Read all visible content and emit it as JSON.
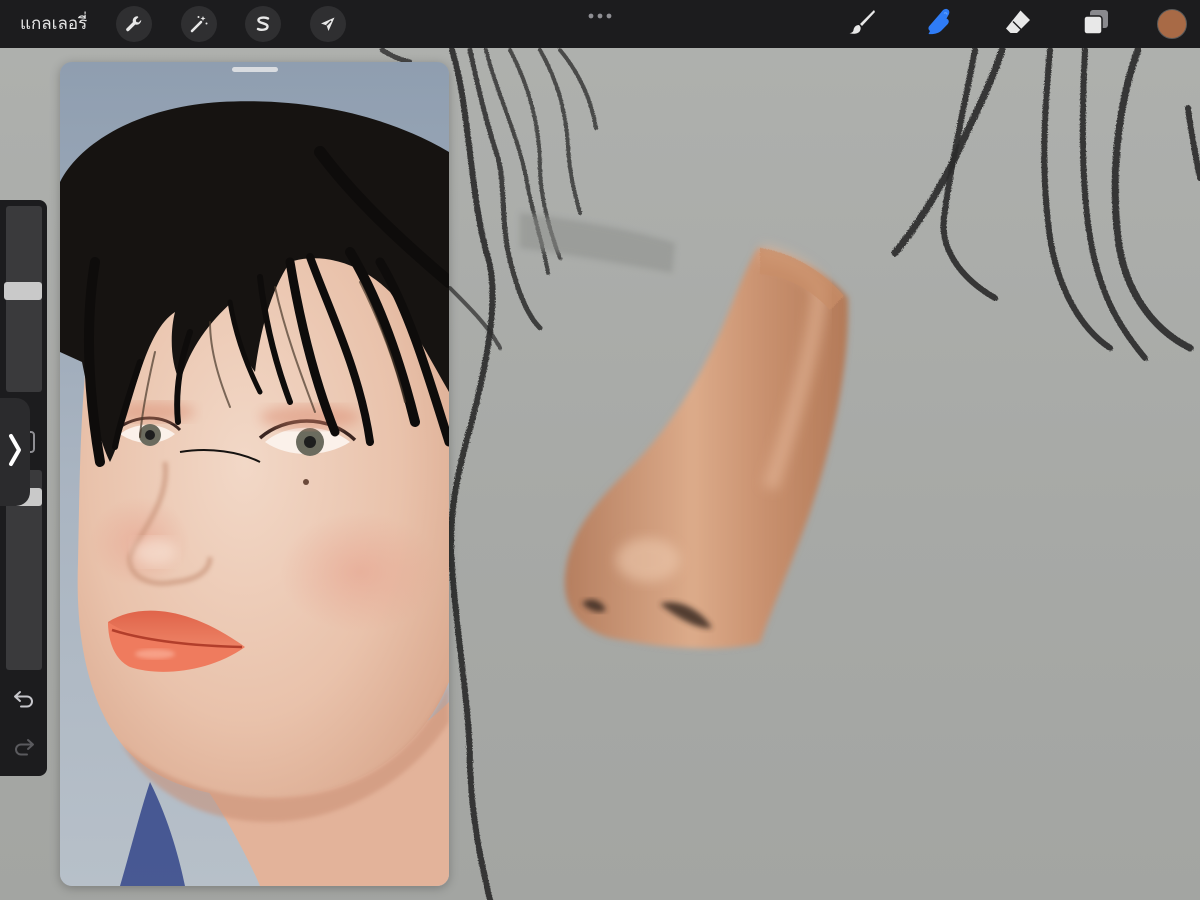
{
  "toolbar": {
    "gallery_label": "แกลเลอรี่",
    "left_tools": [
      {
        "name": "actions",
        "icon": "wrench-icon"
      },
      {
        "name": "adjustments",
        "icon": "magic-wand-icon"
      },
      {
        "name": "selection",
        "icon": "selection-s-icon"
      },
      {
        "name": "transform",
        "icon": "arrow-cursor-icon"
      }
    ],
    "right_tools": [
      {
        "name": "brush",
        "icon": "brush-icon",
        "active": false
      },
      {
        "name": "smudge",
        "icon": "smudge-finger-icon",
        "active": true
      },
      {
        "name": "eraser",
        "icon": "eraser-icon",
        "active": false
      },
      {
        "name": "layers",
        "icon": "layers-icon",
        "active": false
      }
    ],
    "more_icon": "more-dots-icon",
    "current_color": "#a86a46"
  },
  "sidebar": {
    "brush_size_level": 0.55,
    "opacity_level": 0.9,
    "modify_button_icon": "square-modify-icon",
    "collapse_icon": "chevron-right-icon",
    "undo_icon": "undo-icon",
    "redo_icon": "redo-icon"
  },
  "colors": {
    "toolbar_bg": "#1c1c1e",
    "accent_active": "#2f7cf6",
    "canvas_bg": "#a8aaa7",
    "skin": "#d29b78"
  }
}
